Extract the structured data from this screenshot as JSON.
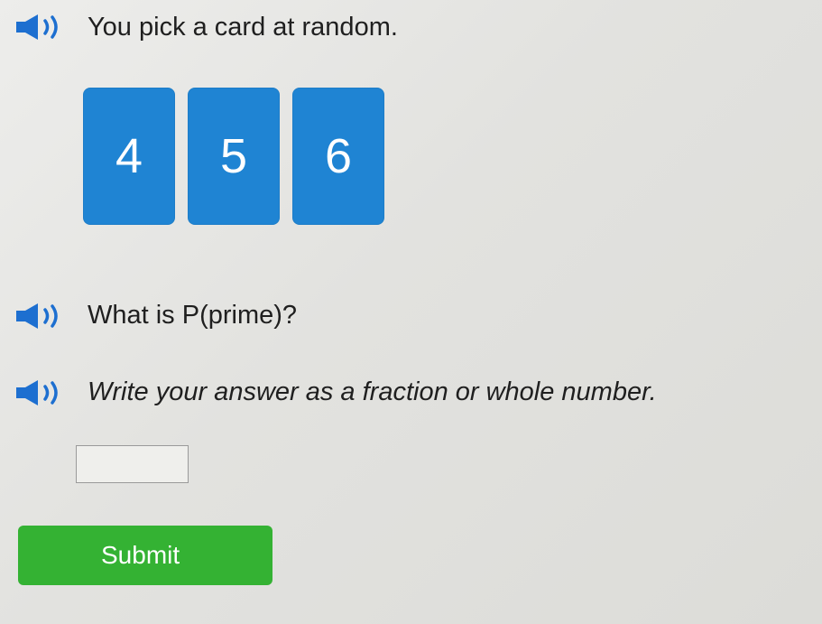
{
  "question": {
    "intro": "You pick a card at random.",
    "cards": [
      "4",
      "5",
      "6"
    ],
    "ask": "What is P(prime)?",
    "instruction": "Write your answer as a fraction or whole number."
  },
  "answer": {
    "value": ""
  },
  "submit": {
    "label": "Submit"
  },
  "colors": {
    "card_blue": "#1f84d3",
    "submit_green": "#34b233",
    "speaker": "#1d6fd0"
  },
  "icons": {
    "speaker": "speaker-icon"
  }
}
